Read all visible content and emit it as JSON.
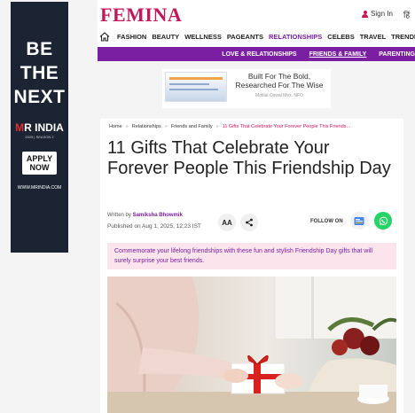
{
  "side_ad": {
    "headline": [
      "BE",
      "THE",
      "NEXT"
    ],
    "brand_prefix": "M",
    "brand_rest": "R INDIA",
    "season": "2025 | SEASON 2",
    "cta": [
      "APPLY",
      "NOW"
    ],
    "url": "WWW.MRINDIA.COM"
  },
  "header": {
    "logo": "FEMINA",
    "signin": "Sign In",
    "lang": "हिं",
    "nav": [
      "FASHION",
      "BEAUTY",
      "WELLNESS",
      "PAGEANTS",
      "RELATIONSHIPS",
      "CELEBS",
      "TRAVEL",
      "TRENDING"
    ],
    "nav_active": "RELATIONSHIPS",
    "subnav": [
      "LOVE & RELATIONSHIPS",
      "FRIENDS & FAMILY",
      "PARENTING"
    ],
    "subnav_active": "FRIENDS & FAMILY"
  },
  "mid_ad": {
    "line1": "Built For The Bold,",
    "line2": "Researched For The Wise",
    "fine": "Motilal Oswal Mex. NFO"
  },
  "article": {
    "breadcrumb": [
      "Home",
      "Relationships",
      "Friends and Family",
      "11 Gifts That Celebrate Your Forever People This Friends..."
    ],
    "title": "11 Gifts That Celebrate Your Forever People This Friendship Day",
    "written_by_label": "Written by",
    "author": "Samiksha Bhowmik",
    "published": "Published on Aug 1, 2025, 12:23 IST",
    "font_btn": "AA",
    "follow_label": "FOLLOW ON",
    "summary": "Commemorate your lifelong friendships with these fun and stylish Friendship Day gifts that will surely surprise your best friends."
  },
  "colors": {
    "brand": "#c2185b",
    "purple": "#7b1fa2",
    "summary_bg": "#fce4ec"
  }
}
